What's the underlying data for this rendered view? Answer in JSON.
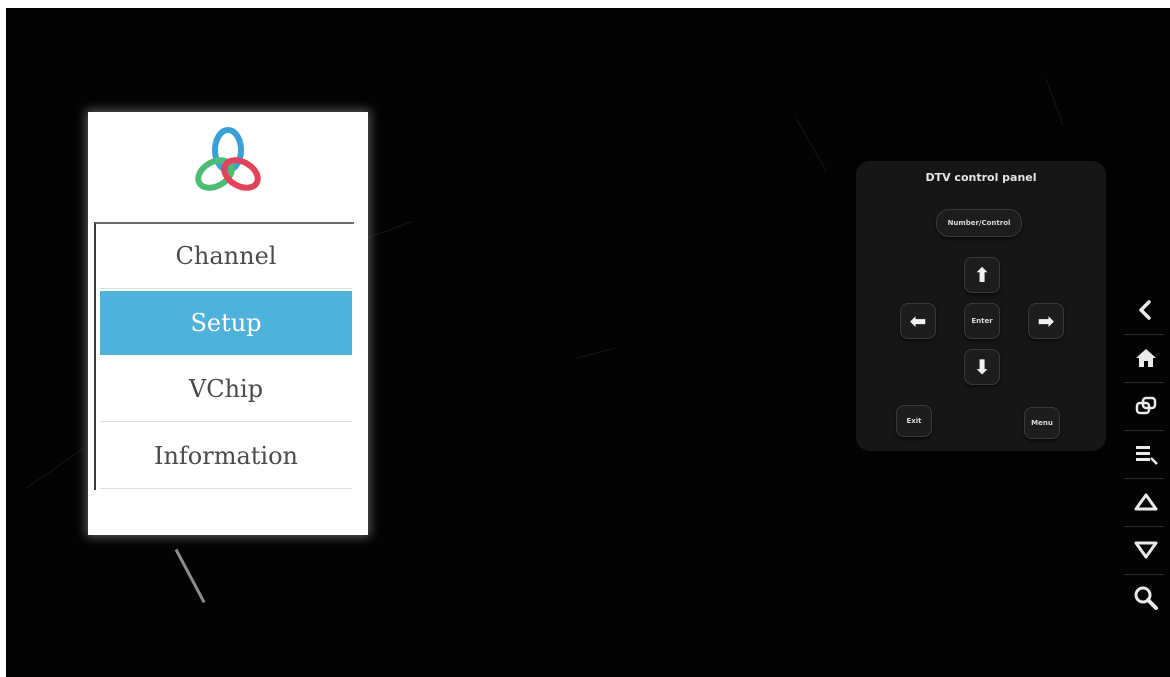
{
  "menu": {
    "items": [
      {
        "label": "Channel",
        "selected": false
      },
      {
        "label": "Setup",
        "selected": true
      },
      {
        "label": "VChip",
        "selected": false
      },
      {
        "label": "Information",
        "selected": false
      }
    ],
    "selected_color": "#4fb2db"
  },
  "control_panel": {
    "title": "DTV control panel",
    "number_button": "Number/Control",
    "enter_button": "Enter",
    "exit_button": "Exit",
    "menu_button": "Menu",
    "up_icon": "arrow-up-icon",
    "down_icon": "arrow-down-icon",
    "left_icon": "arrow-left-icon",
    "right_icon": "arrow-right-icon"
  },
  "sidebar": {
    "icons": [
      "back-icon",
      "home-icon",
      "recent-apps-icon",
      "menu-icon",
      "volume-up-icon",
      "volume-down-icon",
      "search-icon"
    ]
  }
}
